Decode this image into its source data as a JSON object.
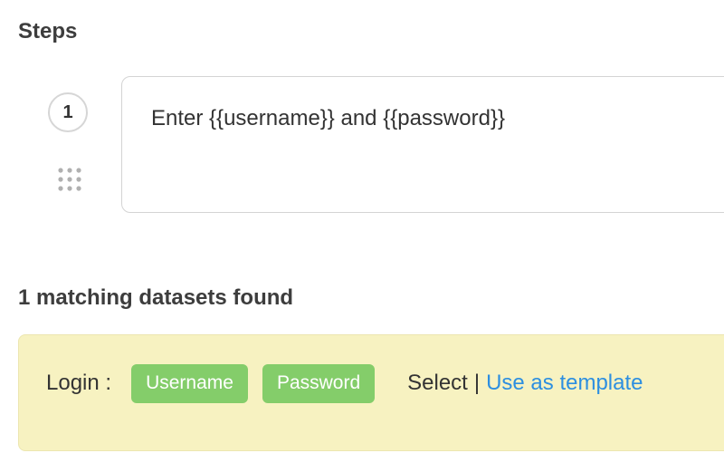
{
  "steps_section": {
    "title": "Steps",
    "steps": [
      {
        "number": "1",
        "text": "Enter {{username}} and {{password}}"
      }
    ]
  },
  "datasets_section": {
    "title": "1 matching datasets found",
    "datasets": [
      {
        "name": "Login :",
        "fields": [
          "Username",
          "Password"
        ],
        "select_label": "Select",
        "separator": "|",
        "template_label": "Use as template"
      }
    ]
  },
  "colors": {
    "tag_bg": "#84cd6a",
    "dataset_bg": "#f7f2c1",
    "link": "#2d8fe0"
  },
  "icons": {
    "drag_handle": "drag-dots-icon"
  }
}
